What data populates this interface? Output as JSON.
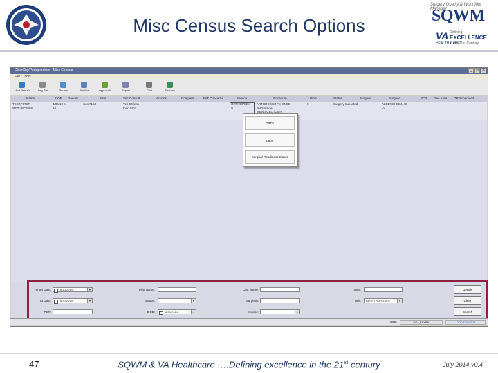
{
  "slide": {
    "title": "Misc Census Search Options",
    "number": "47",
    "footer_pre": "SQWM & VA Healthcare ….Defining excellence in the 21",
    "footer_sup": "st",
    "footer_post": " century",
    "version": "July 2014 v0.4"
  },
  "logo": {
    "top": "Surgery Quality & Workflow Manager",
    "big": "SQWM",
    "va": "VA",
    "care": "HEALTH CARE",
    "def": "Defining",
    "exc": "EXCELLENCE",
    "cent": "in the 21st Century"
  },
  "app": {
    "title": "ClearSky/Perioperative - Misc Census",
    "window_buttons": [
      "_",
      "□",
      "X"
    ],
    "menu": [
      "File",
      "Tools"
    ],
    "toolbar": [
      {
        "label": "New Search",
        "icon": "new-search-icon",
        "color": "#3a78c8"
      },
      {
        "label": "Log Out",
        "icon": "logout-icon",
        "color": "#8a8a8a"
      },
      {
        "label": "Census",
        "icon": "census-icon",
        "color": "#4f8fd0"
      },
      {
        "label": "Worklist",
        "icon": "worklist-icon",
        "color": "#5a82c0"
      },
      {
        "label": "Approvals",
        "icon": "approvals-icon",
        "color": "#6b9e3a"
      },
      {
        "label": "Export",
        "icon": "export-icon",
        "color": "#7f7fb0"
      },
      {
        "label": "Print",
        "icon": "print-icon",
        "color": "#777777"
      },
      {
        "label": "Refresh",
        "icon": "refresh-icon",
        "color": "#3b8f5a"
      }
    ],
    "columns": [
      "Name",
      "DOB",
      "Gender",
      "SSN",
      "Sec Consult",
      "Actions",
      "Complete",
      "PAT Concerns",
      "Service",
      "Procedure",
      "DOS",
      "Status",
      "Surgeon",
      "Surgeon",
      "PCP",
      "Sec Area",
      "OR Scheduled"
    ],
    "row": {
      "name": "TEST,FIRST\nORTHOPEDIC",
      "dob": "4/05/19 M\n64",
      "ssn": "xxxx7158",
      "sec": "Yes 60 less\nthan 50%",
      "service": "ORTHOPEDI\nC",
      "procedure": "ARTHROSCOPY, KNEE\nSURGICAL;\nMENISCECTOMY",
      "dos": "0",
      "status": "Surgery Indicated",
      "surgeon": "ALBERSHEIM,HO\nLY"
    },
    "context_menu": [
      "OPTS",
      "Labs",
      "Surgical Readiness Status"
    ],
    "search": {
      "from_date_label": "From Date:",
      "from_date_value": "6/10/2014",
      "to_date_label": "To Date:",
      "to_date_value": "6/30/2014",
      "pcp_label": "PCP:",
      "first_name_label": "First Name:",
      "status_label": "Status:",
      "dob_label": "DOB:",
      "dob_value": "6/05/2014",
      "last_name_label": "Last Name:",
      "surgeon_label": "Surgeon:",
      "service_label": "Service:",
      "ssn_label": "SSN:",
      "unit_label": "Unit:",
      "unit_value": "BEORTHOPEDICS",
      "details_button": "Details",
      "clear_button": "Clear",
      "search_button": "Search"
    },
    "status": {
      "user_label": "User:",
      "user": "USA,BXYEN",
      "time": "12:10 6/10/2014"
    }
  }
}
